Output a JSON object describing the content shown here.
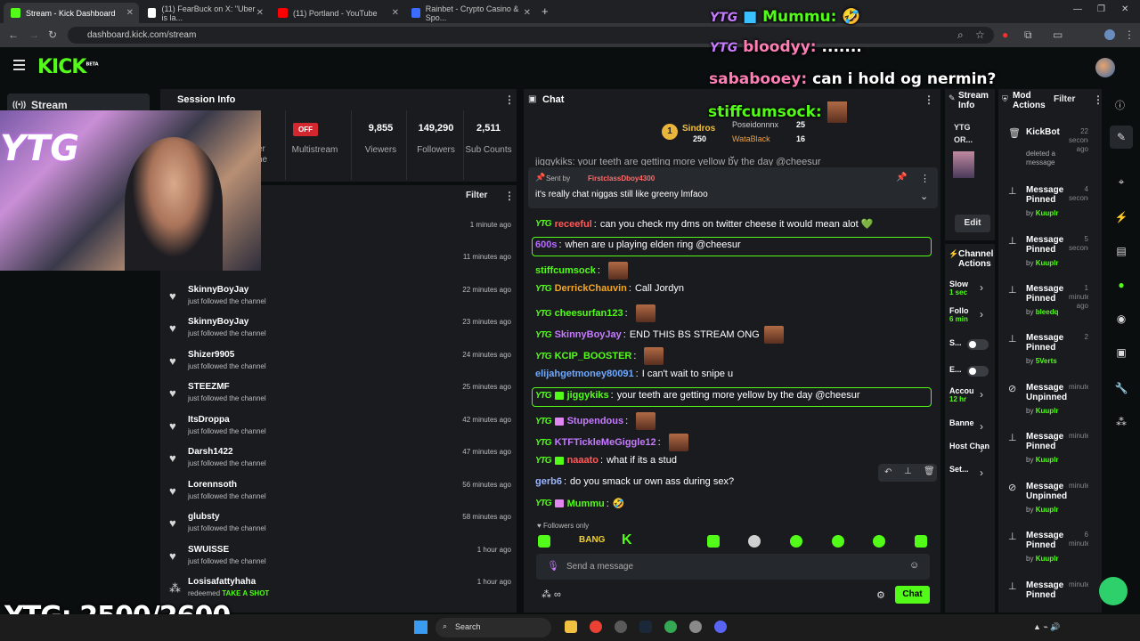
{
  "browser": {
    "tabs": [
      {
        "label": "Stream - Kick Dashboard",
        "active": true,
        "color": "#53fc18"
      },
      {
        "label": "(11) FearBuck on X: \"Uber is la...",
        "active": false,
        "color": "#ffffff"
      },
      {
        "label": "(11) Portland - YouTube",
        "active": false,
        "color": "#ff0000"
      },
      {
        "label": "Rainbet - Crypto Casino & Spo...",
        "active": false,
        "color": "#3a6cff"
      }
    ],
    "url": "dashboard.kick.com/stream"
  },
  "kick": {
    "logo": "KICK",
    "logo_badge": "BETA",
    "nav_stream": "Stream"
  },
  "session": {
    "title": "Session Info",
    "multistream_badge": "OFF",
    "stats": [
      {
        "value": "",
        "label": "Multistream"
      },
      {
        "value": "9,855",
        "label": "Viewers"
      },
      {
        "value": "149,290",
        "label": "Followers"
      },
      {
        "value": "2,511",
        "label": "Sub Counts"
      }
    ],
    "partial_label": "er\nne"
  },
  "activity": {
    "filter_label": "Filter",
    "items": [
      {
        "name": "",
        "sub": "channel",
        "time": "1 minute ago"
      },
      {
        "name": "",
        "sub": "channel",
        "time": "11 minutes ago"
      },
      {
        "name": "SkinnyBoyJay",
        "sub": "just followed the channel",
        "time": "22 minutes ago"
      },
      {
        "name": "SkinnyBoyJay",
        "sub": "just followed the channel",
        "time": "23 minutes ago"
      },
      {
        "name": "Shizer9905",
        "sub": "just followed the channel",
        "time": "24 minutes ago"
      },
      {
        "name": "STEEZMF",
        "sub": "just followed the channel",
        "time": "25 minutes ago"
      },
      {
        "name": "ItsDroppa",
        "sub": "just followed the channel",
        "time": "42 minutes ago"
      },
      {
        "name": "Darsh1422",
        "sub": "just followed the channel",
        "time": "47 minutes ago"
      },
      {
        "name": "Lorennsoth",
        "sub": "just followed the channel",
        "time": "56 minutes ago"
      },
      {
        "name": "glubsty",
        "sub": "just followed the channel",
        "time": "58 minutes ago"
      },
      {
        "name": "SWUISSE",
        "sub": "just followed the channel",
        "time": "1 hour ago"
      },
      {
        "name": "Losisafattyhaha",
        "sub": "redeemed",
        "sub_highlight": "TAKE A SHOT",
        "time": "1 hour ago"
      }
    ]
  },
  "chat": {
    "title": "Chat",
    "leaderboard": {
      "rank": "1",
      "first": {
        "name": "Sindros",
        "count": "250"
      },
      "second": {
        "name": "Poseidonnnx",
        "count": "25"
      },
      "third": {
        "name": "WataBlack",
        "count": "16"
      }
    },
    "pinned": {
      "sent_by_label": "Sent by",
      "sender": "FirstclassDboy4300",
      "message": "it's really chat niggas still like greeny lmfaoo"
    },
    "cut_line": "jiggykiks: your teeth are getting more yellow by the day @cheesur",
    "messages": [
      {
        "badge": "YTG",
        "user": "receeful",
        "color": "#ff5a5a",
        "text": "can you check my dms on twitter cheese it would mean alot 💚"
      },
      {
        "badge": "",
        "user": "600s",
        "color": "#b66dff",
        "text": "when are u playing elden ring @cheesur",
        "highlight": true
      },
      {
        "badge": "",
        "user": "stiffcumsock",
        "color": "#53fc18",
        "text": "",
        "emote": true
      },
      {
        "badge": "YTG",
        "user": "DerrickChauvin",
        "color": "#f5a623",
        "text": "Call Jordyn"
      },
      {
        "badge": "YTG",
        "user": "cheesurfan123",
        "color": "#53fc18",
        "text": "",
        "emote": true
      },
      {
        "badge": "YTG",
        "user": "SkinnyBoyJay",
        "color": "#c67bff",
        "text": "END THIS BS STREAM ONG",
        "emote": true
      },
      {
        "badge": "YTG",
        "user": "KCIP_BOOSTER",
        "color": "#53fc18",
        "text": "",
        "emote": true
      },
      {
        "badge": "",
        "user": "elijahgetmoney80091",
        "color": "#6fa8ff",
        "text": "I can't wait to snipe u"
      },
      {
        "badge": "YTG",
        "user": "jiggykiks",
        "color": "#53fc18",
        "text": "your teeth are getting more yellow by the day @cheesur",
        "highlight": true
      },
      {
        "badge": "YTG",
        "user": "Stupendous",
        "color": "#c67bff",
        "text": "",
        "emote": true
      },
      {
        "badge": "YTG",
        "user": "KTFTickleMeGiggle12",
        "color": "#c67bff",
        "text": "",
        "emote": true
      },
      {
        "badge": "YTG",
        "user": "naaato",
        "color": "#ff5a5a",
        "text": "what if its a stud"
      },
      {
        "badge": "",
        "user": "gerb6",
        "color": "#9ab4ff",
        "text": "do you smack ur own ass during sex?"
      },
      {
        "badge": "YTG",
        "user": "Mummu",
        "color": "#53fc18",
        "text": "🤣"
      }
    ],
    "followers_only": "Followers only",
    "input_placeholder": "Send a message",
    "chat_button": "Chat"
  },
  "stream_info": {
    "title": "Stream Info",
    "line1": "YTG",
    "line2": "OR...",
    "edit_label": "Edit"
  },
  "channel_actions": {
    "title": "Channel Actions",
    "items": [
      {
        "label": "Slow",
        "sub": "1 sec"
      },
      {
        "label": "Follo",
        "sub": "6 min"
      },
      {
        "label": "S...",
        "sub": ""
      },
      {
        "label": "E...",
        "sub": ""
      },
      {
        "label": "Accou",
        "sub": "12 hr"
      },
      {
        "label": "Banne",
        "sub": ""
      },
      {
        "label": "Host Chan",
        "sub": ""
      },
      {
        "label": "Set...",
        "sub": ""
      }
    ]
  },
  "mod_actions": {
    "title": "Mod Actions",
    "filter_label": "Filter",
    "items": [
      {
        "title": "KickBot",
        "detail": "deleted a message",
        "time": "22 seconds ago",
        "by": ""
      },
      {
        "title": "Message Pinned",
        "time": "4 seconds",
        "by": "Kuuplr"
      },
      {
        "title": "Message Pinned",
        "time": "5 seconds",
        "by": "Kuuplr"
      },
      {
        "title": "Message Pinned",
        "time": "1 minute ago",
        "by": "bleedq"
      },
      {
        "title": "Message Pinned",
        "time": "2",
        "by": "5Verts"
      },
      {
        "title": "Message Unpinned",
        "time": "minute",
        "by": "Kuuplr"
      },
      {
        "title": "Message Pinned",
        "time": "minute",
        "by": "Kuuplr"
      },
      {
        "title": "Message Unpinned",
        "time": "minute",
        "by": "Kuuplr"
      },
      {
        "title": "Message Pinned",
        "time": "6 minute",
        "by": "Kuuplr"
      },
      {
        "title": "Message Pinned",
        "time": "minute",
        "by": ""
      }
    ],
    "by_label": "by"
  },
  "overlays": {
    "line1_name": "Mummu:",
    "line2_name": "bloodyy:",
    "line2_text": ".......",
    "line3_name": "sababooey:",
    "line3_text": "can i hold og nermin?",
    "line4_name": "stiffcumsock:",
    "goal_text": "YTG: 2500/2600",
    "colors": {
      "green": "#53fc18",
      "pink": "#ff7eb6",
      "purple": "#c67bff"
    }
  },
  "taskbar": {
    "search_label": "Search"
  }
}
